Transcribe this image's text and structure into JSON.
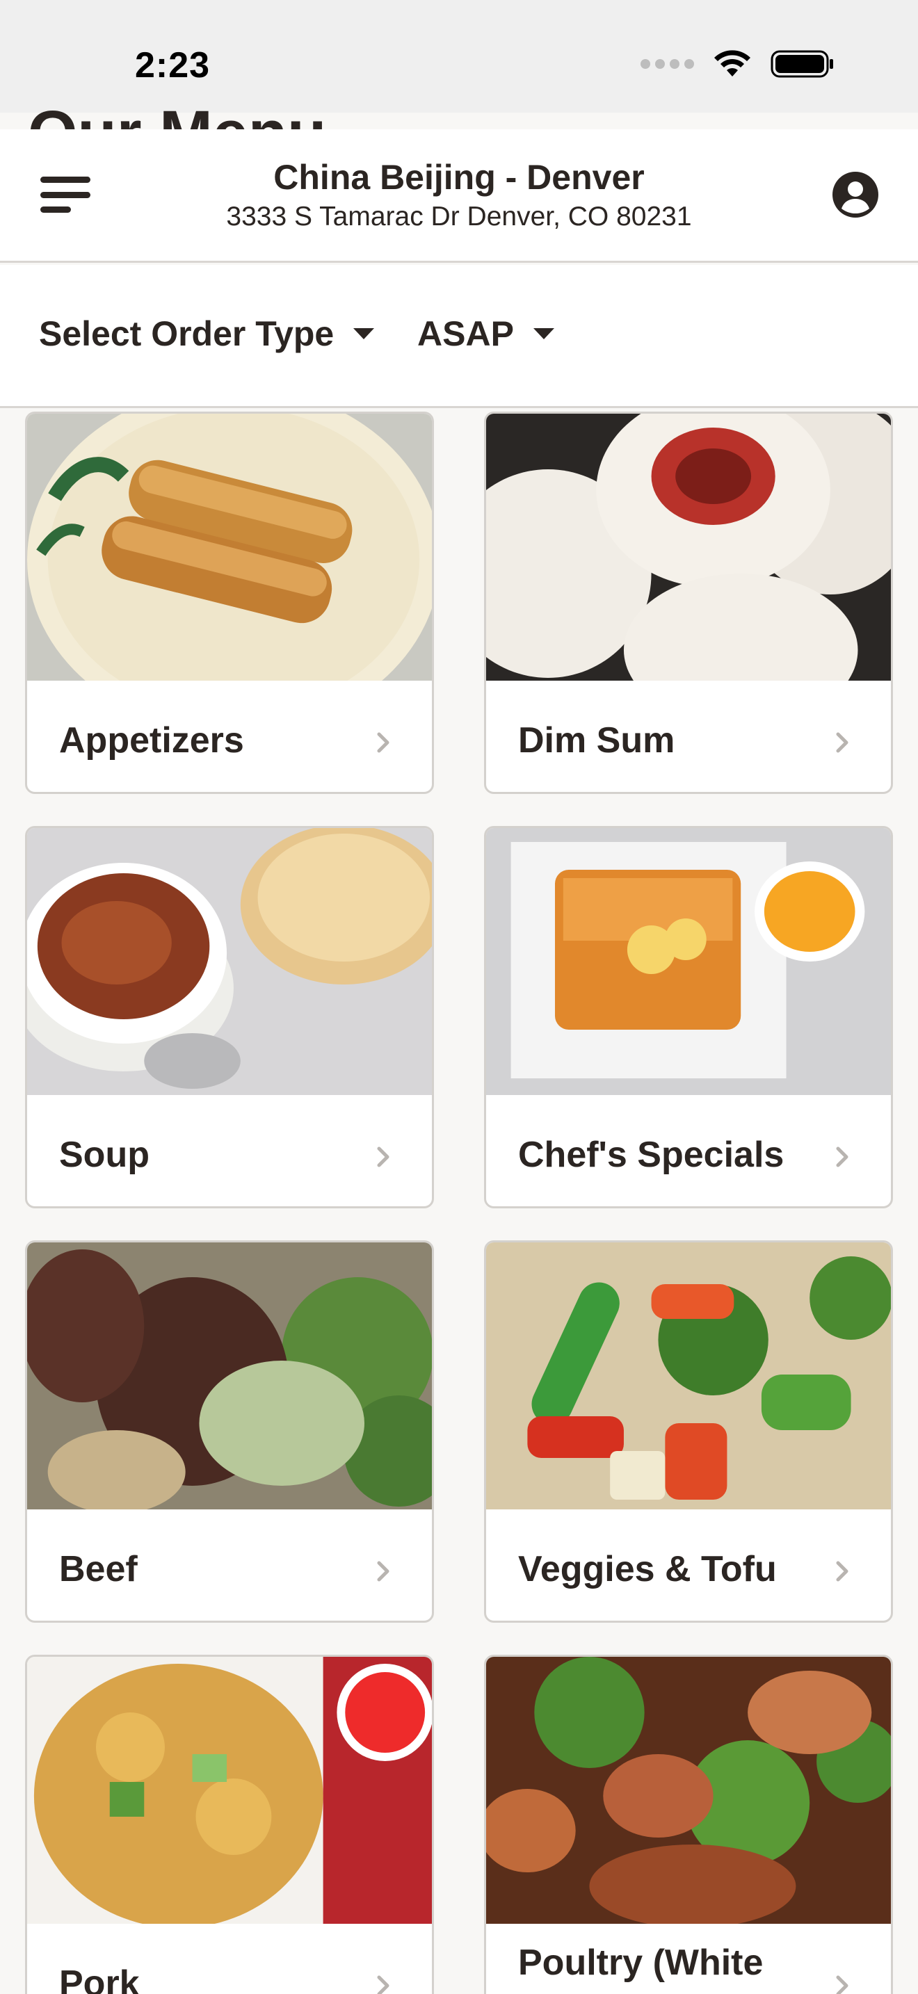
{
  "status_bar": {
    "time": "2:23"
  },
  "underlying_title": "Our Menu",
  "header": {
    "restaurant_name": "China Beijing - Denver",
    "address": "3333 S Tamarac Dr Denver, CO 80231"
  },
  "order_bar": {
    "order_type_label": "Select Order Type",
    "time_label": "ASAP"
  },
  "categories": [
    {
      "label": "Appetizers",
      "image": "egg-rolls-photo"
    },
    {
      "label": "Dim Sum",
      "image": "steamed-buns-photo"
    },
    {
      "label": "Soup",
      "image": "hot-sour-soup-photo"
    },
    {
      "label": "Chef's Specials",
      "image": "fried-chicken-lemon-photo"
    },
    {
      "label": "Beef",
      "image": "beef-broccoli-photo"
    },
    {
      "label": "Veggies & Tofu",
      "image": "stir-fried-vegetables-photo"
    },
    {
      "label": "Pork",
      "image": "sweet-sour-pork-photo"
    },
    {
      "label": "Poultry (White",
      "image": "chicken-broccoli-photo"
    }
  ],
  "colors": {
    "text": "#2b2522",
    "background": "#f8f7f5",
    "card_border": "#d4d1cd",
    "chevron": "#b8b4b0"
  }
}
